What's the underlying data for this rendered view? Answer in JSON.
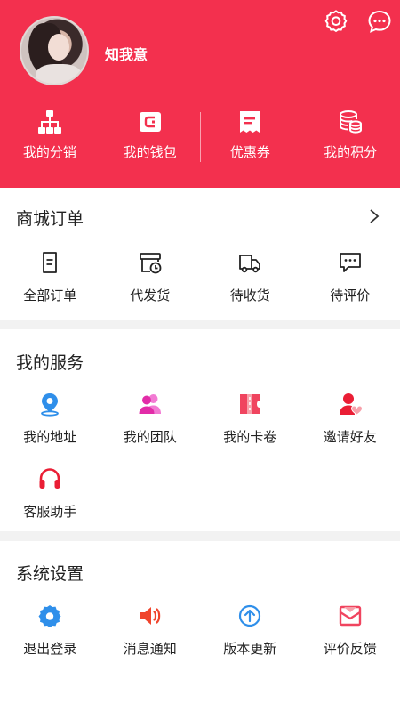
{
  "profile": {
    "username": "知我意"
  },
  "header_menu": [
    {
      "label": "我的分销",
      "icon": "org-tree-icon"
    },
    {
      "label": "我的钱包",
      "icon": "wallet-icon"
    },
    {
      "label": "优惠券",
      "icon": "coupon-icon"
    },
    {
      "label": "我的积分",
      "icon": "coins-icon"
    }
  ],
  "orders": {
    "title": "商城订单",
    "items": [
      {
        "label": "全部订单",
        "icon": "document-icon"
      },
      {
        "label": "代发货",
        "icon": "box-clock-icon"
      },
      {
        "label": "待收货",
        "icon": "truck-icon"
      },
      {
        "label": "待评价",
        "icon": "chat-icon"
      }
    ]
  },
  "services": {
    "title": "我的服务",
    "items": [
      {
        "label": "我的地址",
        "icon": "location-pin-icon",
        "color": "#2f8fea"
      },
      {
        "label": "我的团队",
        "icon": "team-icon",
        "color": "#e83cb7"
      },
      {
        "label": "我的卡卷",
        "icon": "ticket-icon",
        "color": "#f0445f"
      },
      {
        "label": "邀请好友",
        "icon": "invite-friend-icon",
        "color": "#ea1e35"
      },
      {
        "label": "客服助手",
        "icon": "headset-icon",
        "color": "#ea1e35"
      }
    ]
  },
  "settings": {
    "title": "系统设置",
    "items": [
      {
        "label": "退出登录",
        "icon": "gear-icon",
        "color": "#2f8fea"
      },
      {
        "label": "消息通知",
        "icon": "speaker-icon",
        "color": "#f0442c"
      },
      {
        "label": "版本更新",
        "icon": "upload-arrow-icon",
        "color": "#2f8fea"
      },
      {
        "label": "评价反馈",
        "icon": "feedback-mail-icon",
        "color": "#f0445f"
      }
    ]
  },
  "colors": {
    "brand_red": "#f3304e",
    "divider_gray": "#f2f2f2"
  }
}
